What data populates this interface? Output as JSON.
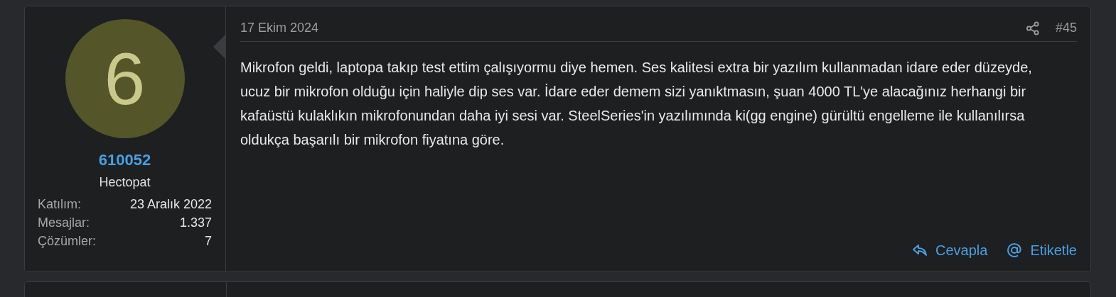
{
  "posts": [
    {
      "avatar": {
        "letter": "6",
        "color": "#55552a"
      },
      "username": "610052",
      "user_title": "Hectopat",
      "stats": [
        {
          "label": "Katılım:",
          "value": "23 Aralık 2022"
        },
        {
          "label": "Mesajlar:",
          "value": "1.337"
        },
        {
          "label": "Çözümler:",
          "value": "7"
        }
      ],
      "date": "17 Ekim 2024",
      "number": "#45",
      "body": "Mikrofon geldi, laptopa takıp test ettim çalışıyormu diye hemen. Ses kalitesi extra bir yazılım kullanmadan idare eder düzeyde, ucuz bir mikrofon olduğu için haliyle dip ses var. İdare eder demem sizi yanıktmasın, şuan 4000 TL'ye alacağınız herhangi bir kafaüstü kulaklıkın mikrofonundan daha iyi sesi var. SteelSeries'in yazılımında ki(gg engine) gürültü engelleme ile kullanılırsa oldukça başarılı bir mikrofon fiyatına göre.",
      "actions": [
        {
          "kind": "reply",
          "label": "Cevapla"
        },
        {
          "kind": "mention",
          "label": "Etiketle"
        }
      ]
    }
  ]
}
